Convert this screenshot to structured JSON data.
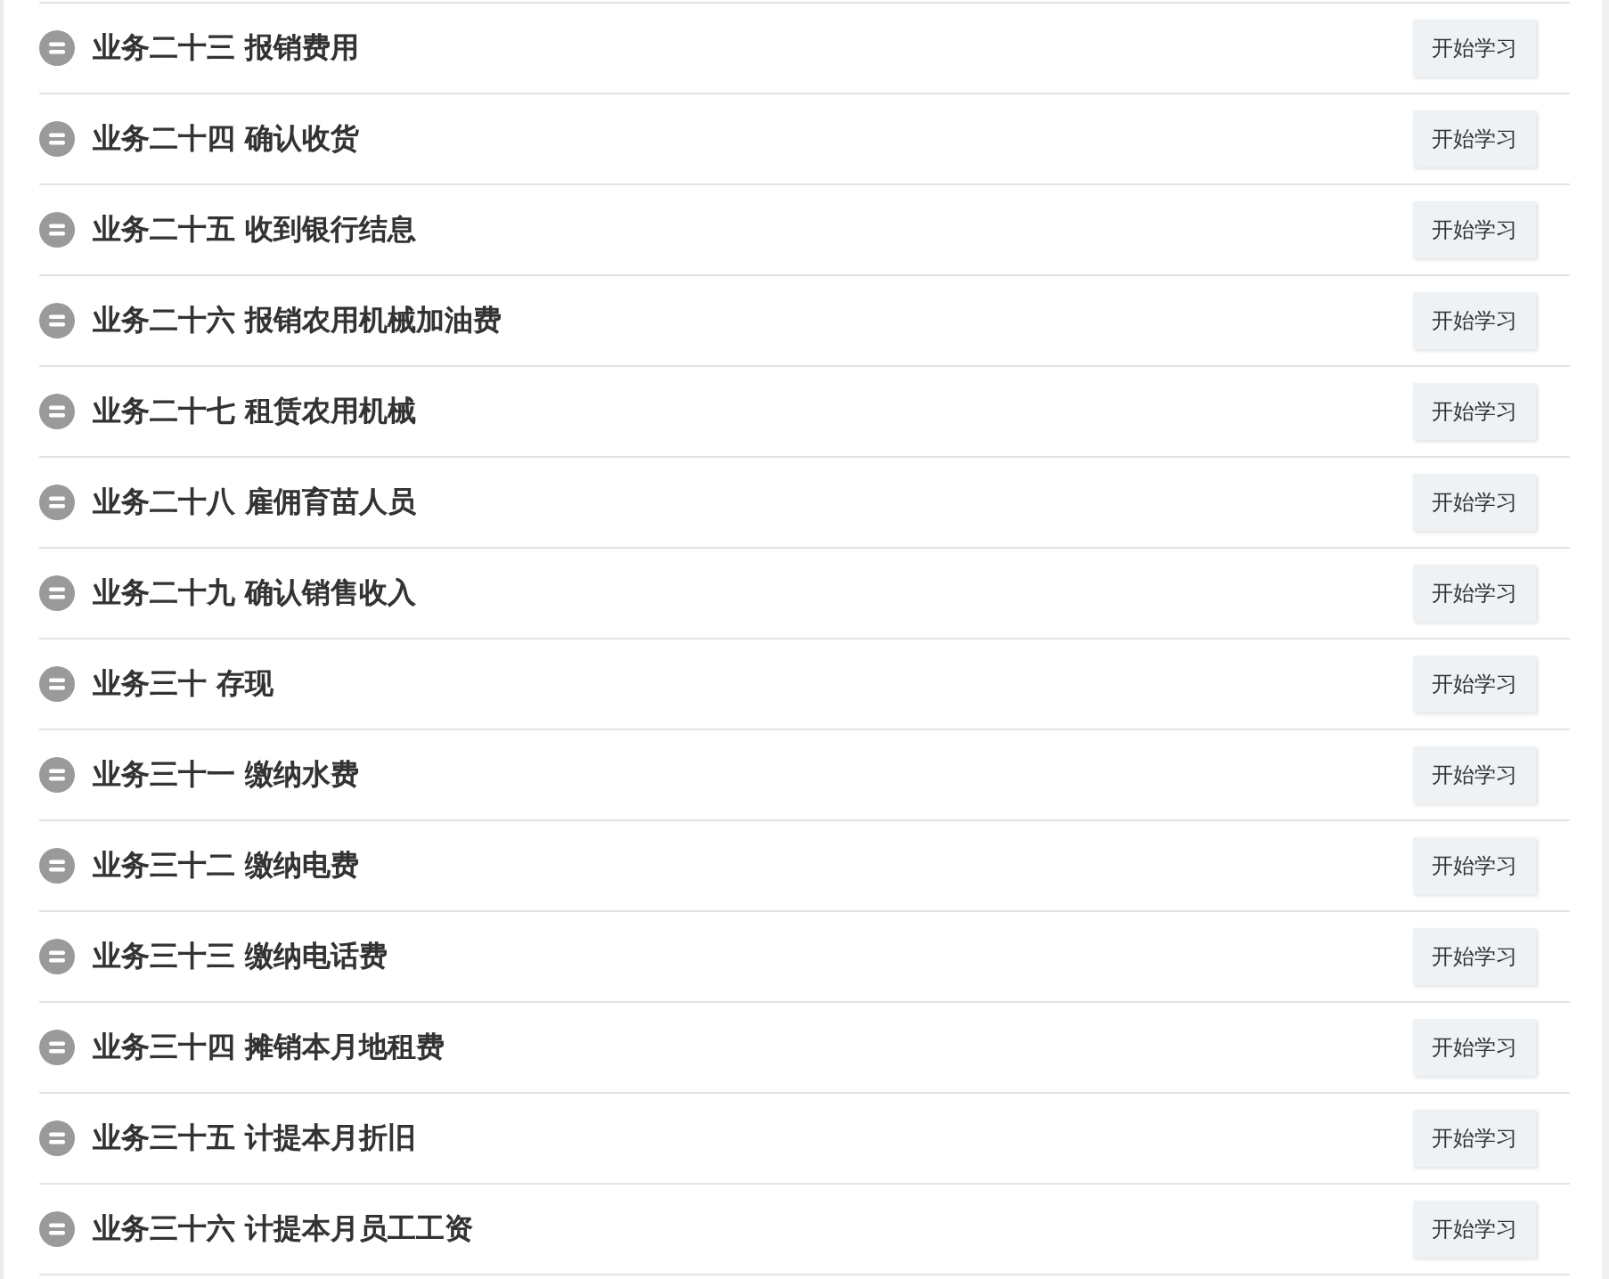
{
  "lessons": [
    {
      "title": "业务二十三 报销费用",
      "button": "开始学习"
    },
    {
      "title": "业务二十四 确认收货",
      "button": "开始学习"
    },
    {
      "title": "业务二十五 收到银行结息",
      "button": "开始学习"
    },
    {
      "title": "业务二十六 报销农用机械加油费",
      "button": "开始学习"
    },
    {
      "title": "业务二十七 租赁农用机械",
      "button": "开始学习"
    },
    {
      "title": "业务二十八 雇佣育苗人员",
      "button": "开始学习"
    },
    {
      "title": "业务二十九 确认销售收入",
      "button": "开始学习"
    },
    {
      "title": "业务三十 存现",
      "button": "开始学习"
    },
    {
      "title": "业务三十一 缴纳水费",
      "button": "开始学习"
    },
    {
      "title": "业务三十二 缴纳电费",
      "button": "开始学习"
    },
    {
      "title": "业务三十三 缴纳电话费",
      "button": "开始学习"
    },
    {
      "title": "业务三十四 摊销本月地租费",
      "button": "开始学习"
    },
    {
      "title": "业务三十五 计提本月折旧",
      "button": "开始学习"
    },
    {
      "title": "业务三十六 计提本月员工工资",
      "button": "开始学习"
    }
  ]
}
